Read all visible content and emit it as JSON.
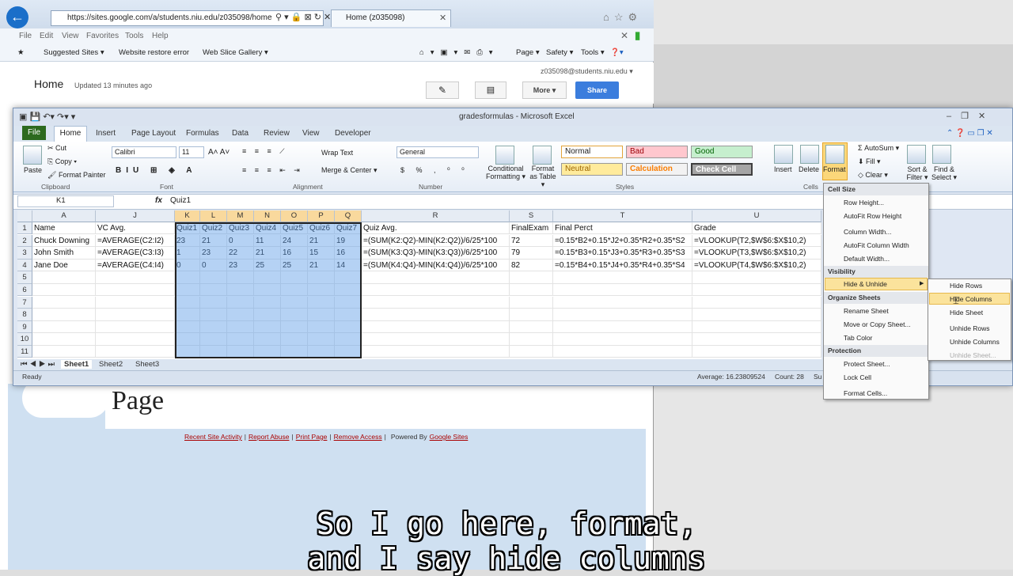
{
  "browser": {
    "url": "https://sites.google.com/a/students.niu.edu/z035098/home",
    "tab_title": "Home (z035098)",
    "menu": [
      "File",
      "Edit",
      "View",
      "Favorites",
      "Tools",
      "Help"
    ],
    "favorites": [
      "Suggested Sites ▾",
      "Website restore error",
      "Web Slice Gallery ▾"
    ],
    "toolbar": [
      "Page ▾",
      "Safety ▾",
      "Tools ▾"
    ]
  },
  "site": {
    "title": "Home",
    "updated": "Updated 13 minutes ago",
    "user": "z035098@students.niu.edu ▾",
    "more": "More ▾",
    "share": "Share",
    "page_heading": "Page",
    "footer": [
      "Recent Site Activity",
      "Report Abuse",
      "Print Page",
      "Remove Access"
    ],
    "powered": "Powered By",
    "google_sites": "Google Sites"
  },
  "excel": {
    "title": "gradesformulas - Microsoft Excel",
    "tabs": [
      "File",
      "Home",
      "Insert",
      "Page Layout",
      "Formulas",
      "Data",
      "Review",
      "View",
      "Developer"
    ],
    "ribbon": {
      "paste": "Paste",
      "cut": "Cut",
      "copy": "Copy ▾",
      "format_painter": "Format Painter",
      "font": "Calibri",
      "size": "11",
      "wrap": "Wrap Text",
      "merge": "Merge & Center ▾",
      "numfmt": "General",
      "cond": "Conditional Formatting ▾",
      "fmt_table": "Format as Table ▾",
      "insert": "Insert",
      "delete": "Delete",
      "format": "Format",
      "autosum": "AutoSum ▾",
      "fill": "Fill ▾",
      "clear": "Clear ▾",
      "sort": "Sort & Filter ▾",
      "find": "Find & Select ▾",
      "styles": [
        "Normal",
        "Bad",
        "Good",
        "Neutral",
        "Calculation",
        "Check Cell"
      ],
      "groups": [
        "Clipboard",
        "Font",
        "Alignment",
        "Number",
        "Styles",
        "Cells"
      ]
    },
    "namebox": "K1",
    "formula": "Quiz1",
    "columns": [
      "A",
      "J",
      "K",
      "L",
      "M",
      "N",
      "O",
      "P",
      "Q",
      "R",
      "S",
      "T",
      "U"
    ],
    "rows": [
      "1",
      "2",
      "3",
      "4",
      "5",
      "6",
      "7",
      "8",
      "9",
      "10",
      "11"
    ],
    "data": [
      [
        "Name",
        "VC Avg.",
        "Quiz1",
        "Quiz2",
        "Quiz3",
        "Quiz4",
        "Quiz5",
        "Quiz6",
        "Quiz7",
        "Quiz Avg.",
        "FinalExam",
        "Final Perct",
        "Grade"
      ],
      [
        "Chuck Downing",
        "=AVERAGE(C2:I2)",
        "23",
        "21",
        "0",
        "11",
        "24",
        "21",
        "19",
        "=(SUM(K2:Q2)-MIN(K2:Q2))/6/25*100",
        "72",
        "=0.15*B2+0.15*J2+0.35*R2+0.35*S2",
        "=VLOOKUP(T2,$W$6:$X$10,2)"
      ],
      [
        "John Smith",
        "=AVERAGE(C3:I3)",
        "1",
        "23",
        "22",
        "21",
        "16",
        "15",
        "16",
        "=(SUM(K3:Q3)-MIN(K3:Q3))/6/25*100",
        "79",
        "=0.15*B3+0.15*J3+0.35*R3+0.35*S3",
        "=VLOOKUP(T3,$W$6:$X$10,2)"
      ],
      [
        "Jane Doe",
        "=AVERAGE(C4:I4)",
        "0",
        "0",
        "23",
        "25",
        "25",
        "21",
        "14",
        "=(SUM(K4:Q4)-MIN(K4:Q4))/6/25*100",
        "82",
        "=0.15*B4+0.15*J4+0.35*R4+0.35*S4",
        "=VLOOKUP(T4,$W$6:$X$10,2)"
      ]
    ],
    "sheets": [
      "Sheet1",
      "Sheet2",
      "Sheet3"
    ],
    "status": {
      "ready": "Ready",
      "average": "Average: 16.23809524",
      "count": "Count: 28",
      "sum": "Su"
    },
    "format_menu": {
      "cell_size": "Cell Size",
      "row_height": "Row Height...",
      "autofit_row": "AutoFit Row Height",
      "col_width": "Column Width...",
      "autofit_col": "AutoFit Column Width",
      "default_width": "Default Width...",
      "visibility": "Visibility",
      "hide_unhide": "Hide & Unhide",
      "organize": "Organize Sheets",
      "rename": "Rename Sheet",
      "move_copy": "Move or Copy Sheet...",
      "tab_color": "Tab Color",
      "protection": "Protection",
      "protect": "Protect Sheet...",
      "lock": "Lock Cell",
      "format_cells": "Format Cells..."
    },
    "submenu": [
      "Hide Rows",
      "Hide Columns",
      "Hide Sheet",
      "Unhide Rows",
      "Unhide Columns",
      "Unhide Sheet..."
    ]
  },
  "caption": {
    "line1": "So I go here, format,",
    "line2": "and I say hide columns"
  }
}
